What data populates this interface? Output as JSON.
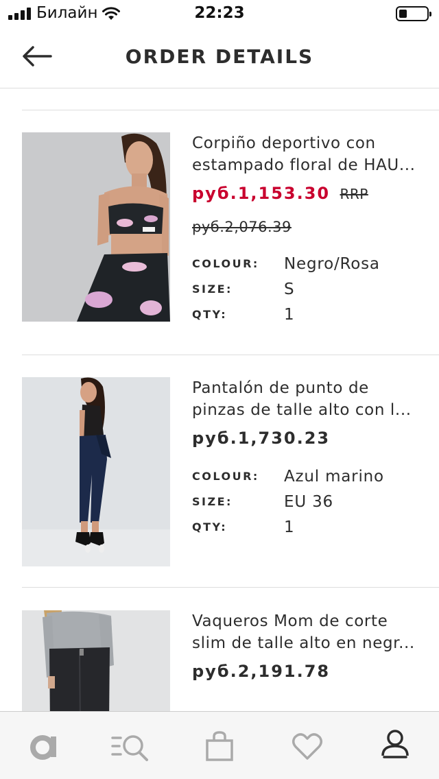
{
  "status_bar": {
    "carrier": "Билайн",
    "time": "22:23"
  },
  "header": {
    "title": "ORDER DETAILS",
    "back_icon": "arrow-left-icon"
  },
  "labels": {
    "colour": "COLOUR:",
    "size": "SIZE:",
    "qty": "QTY:",
    "rrp": "RRP"
  },
  "items": [
    {
      "name_line1": "Corpiño deportivo con",
      "name_line2": "estampado floral de HAU...",
      "price": "руб.1,153.30",
      "old_price": "руб.2,076.39",
      "colour": "Negro/Rosa",
      "size": "S",
      "qty": "1"
    },
    {
      "name_line1": "Pantalón de punto de",
      "name_line2": "pinzas de talle alto con l...",
      "price": "руб.1,730.23",
      "colour": "Azul marino",
      "size": "EU 36",
      "qty": "1"
    },
    {
      "name_line1": "Vaqueros Mom de corte",
      "name_line2": "slim de talle alto en negr...",
      "price": "руб.2,191.78"
    }
  ],
  "tab_bar": {
    "icons": [
      "brand-a-icon",
      "search-menu-icon",
      "bag-icon",
      "heart-icon",
      "account-icon"
    ]
  },
  "colors": {
    "sale": "#c9002e",
    "text": "#2d2d2d",
    "tab_icon": "#aaaaaa"
  }
}
